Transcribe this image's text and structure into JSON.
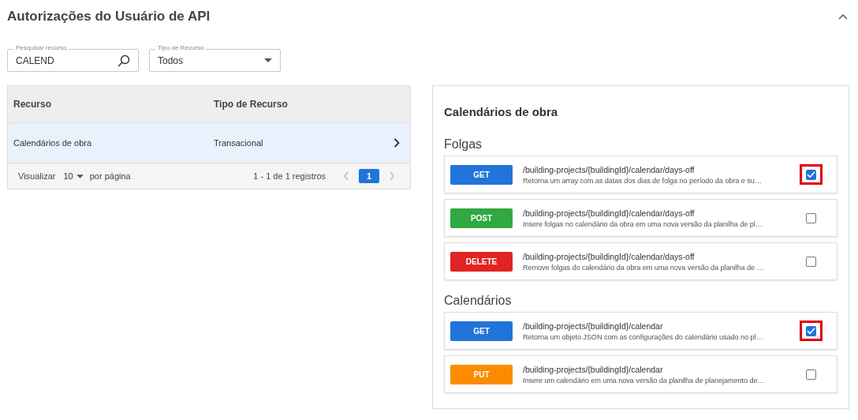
{
  "header": {
    "title": "Autorizações do Usuário de API",
    "expanded": true
  },
  "filters": {
    "search": {
      "label": "Pesquisar recurso",
      "value": "CALEND"
    },
    "type": {
      "label": "Tipo de Recurso",
      "value": "Todos"
    }
  },
  "table": {
    "columns": [
      "Recurso",
      "Tipo de Recurso"
    ],
    "rows": [
      {
        "cells": [
          "Calendários de obra",
          "Transacional"
        ],
        "selected": true
      }
    ],
    "footer": {
      "show_label": "Visualizar",
      "page_size": "10",
      "per_page": "por página",
      "range": "1 - 1 de 1 registros",
      "pages": [
        {
          "label": "1",
          "selected": true
        }
      ]
    }
  },
  "panel": {
    "title": "Calendários de obra",
    "groups": [
      {
        "title": "Folgas",
        "endpoints": [
          {
            "method": "GET",
            "color": "#2174d9",
            "path": "/building-projects/{buildingId}/calendar/days-off",
            "description": "Retorna um array com as datas dos dias de folga no período da obra e su…",
            "checked": true,
            "highlighted": true
          },
          {
            "method": "POST",
            "color": "#31a943",
            "path": "/building-projects/{buildingId}/calendar/days-off",
            "description": "Insere folgas no calendário da obra em uma nova versão da planilha de pl…",
            "checked": false,
            "highlighted": false
          },
          {
            "method": "DELETE",
            "color": "#e02424",
            "path": "/building-projects/{buildingId}/calendar/days-off",
            "description": "Remove folgas do calendário da obra em uma nova versão da planilha de …",
            "checked": false,
            "highlighted": false
          }
        ]
      },
      {
        "title": "Calendários",
        "endpoints": [
          {
            "method": "GET",
            "color": "#2174d9",
            "path": "/building-projects/{buildingId}/calendar",
            "description": "Retorna um objeto JSON com as configurações do calendário usado no pl…",
            "checked": true,
            "highlighted": true
          },
          {
            "method": "PUT",
            "color": "#fb8c00",
            "path": "/building-projects/{buildingId}/calendar",
            "description": "Insere um calendário em uma nova versão da planilha de planejamento de…",
            "checked": false,
            "highlighted": false
          }
        ]
      }
    ]
  }
}
